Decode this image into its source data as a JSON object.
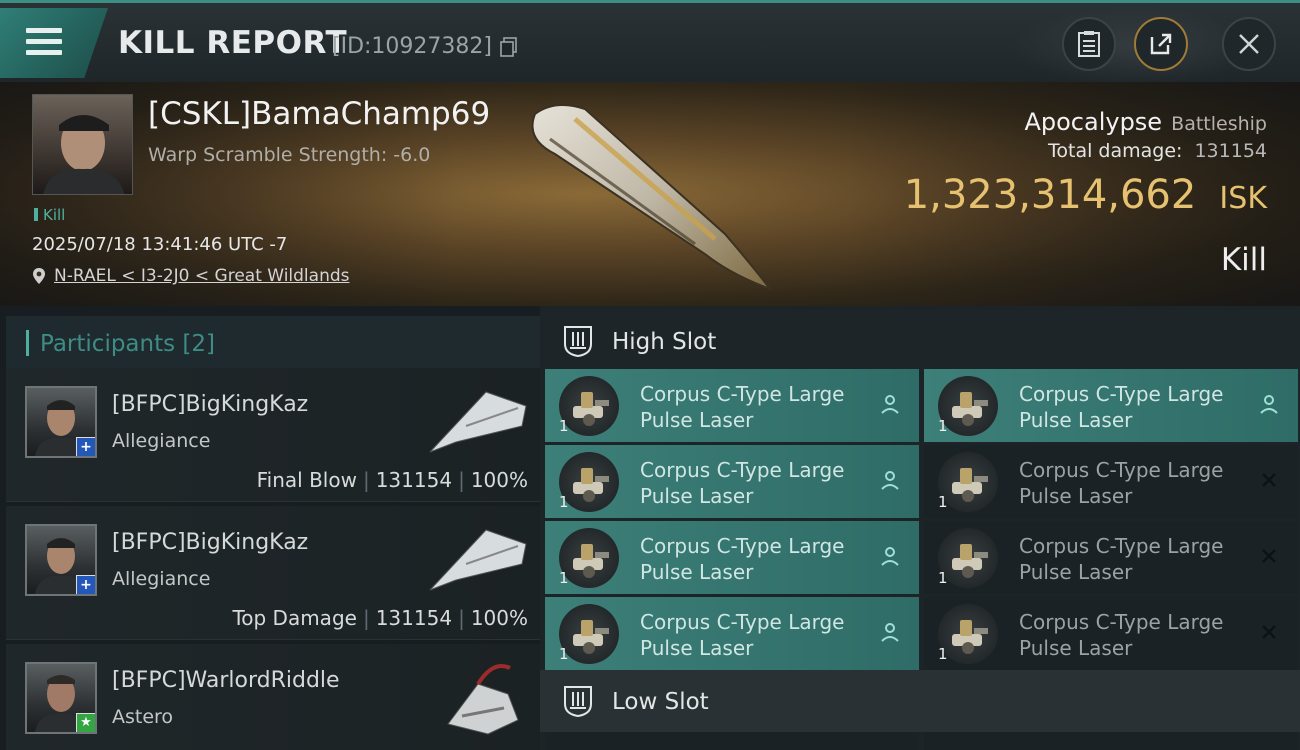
{
  "header": {
    "title": "KILL REPORT",
    "report_id": "[ID:10927382]",
    "icons": [
      "menu-icon",
      "copy-icon",
      "clipboard-icon",
      "share-icon",
      "close-icon"
    ]
  },
  "victim": {
    "name": "[CSKL]BamaChamp69",
    "warp_scramble": "Warp Scramble Strength: -6.0",
    "tag": "Kill",
    "timestamp": "2025/07/18 13:41:46 UTC -7",
    "location": "N-RAEL < I3-2J0 < Great Wildlands",
    "ship_name": "Apocalypse",
    "ship_class": "Battleship",
    "total_damage_label": "Total damage:",
    "total_damage_value": "131154",
    "isk_value": "1,323,314,662",
    "isk_unit": "ISK",
    "result": "Kill"
  },
  "participants": {
    "title": "Participants",
    "count": "[2]",
    "items": [
      {
        "name": "[BFPC]BigKingKaz",
        "ship": "Allegiance",
        "role": "Final Blow",
        "damage": "131154",
        "percent": "100%",
        "badge": "+"
      },
      {
        "name": "[BFPC]BigKingKaz",
        "ship": "Allegiance",
        "role": "Top Damage",
        "damage": "131154",
        "percent": "100%",
        "badge": "+"
      },
      {
        "name": "[BFPC]WarlordRiddle",
        "ship": "Astero",
        "role": "",
        "damage": "",
        "percent": "",
        "badge": "★"
      }
    ]
  },
  "slots": {
    "high_slot_label": "High Slot",
    "low_slot_label": "Low Slot",
    "modules": [
      {
        "line1": "Corpus C-Type Large",
        "line2": "Pulse Laser",
        "qty": "1",
        "state": "dropped"
      },
      {
        "line1": "Corpus C-Type Large",
        "line2": "Pulse Laser",
        "qty": "1",
        "state": "dropped"
      },
      {
        "line1": "Corpus C-Type Large",
        "line2": "Pulse Laser",
        "qty": "1",
        "state": "dropped"
      },
      {
        "line1": "Corpus C-Type Large",
        "line2": "Pulse Laser",
        "qty": "1",
        "state": "destroyed"
      },
      {
        "line1": "Corpus C-Type Large",
        "line2": "Pulse Laser",
        "qty": "1",
        "state": "dropped"
      },
      {
        "line1": "Corpus C-Type Large",
        "line2": "Pulse Laser",
        "qty": "1",
        "state": "destroyed"
      },
      {
        "line1": "Corpus C-Type Large",
        "line2": "Pulse Laser",
        "qty": "1",
        "state": "dropped"
      },
      {
        "line1": "Corpus C-Type Large",
        "line2": "Pulse Laser",
        "qty": "1",
        "state": "destroyed"
      }
    ]
  },
  "colors": {
    "accent": "#3e8c85",
    "active_module": "#3d7f79",
    "isk_gold": "#e6c170"
  }
}
